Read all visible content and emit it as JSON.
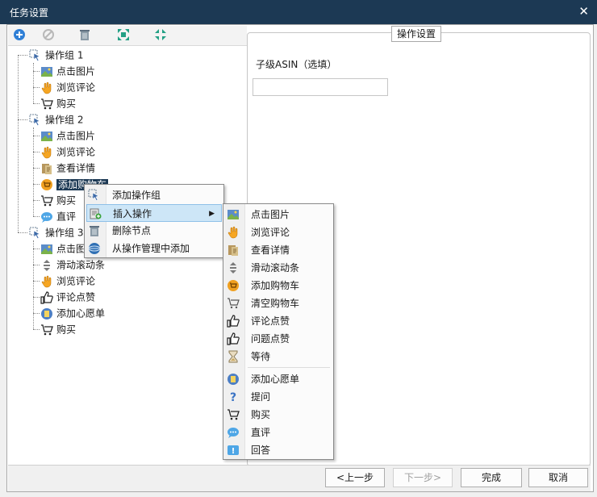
{
  "window": {
    "title": "任务设置",
    "close": "✕"
  },
  "toolbar": [
    {
      "name": "add-icon"
    },
    {
      "name": "disable-icon"
    },
    {
      "name": "delete-icon"
    },
    {
      "name": "expand-icon"
    },
    {
      "name": "collapse-icon"
    }
  ],
  "tree": [
    {
      "label": "操作组 1",
      "level": 0,
      "icon": "cursor-icon"
    },
    {
      "label": "点击图片",
      "level": 1,
      "icon": "image-icon"
    },
    {
      "label": "浏览评论",
      "level": 1,
      "icon": "hand-icon"
    },
    {
      "label": "购买",
      "level": 1,
      "icon": "cart-icon"
    },
    {
      "label": "操作组 2",
      "level": 0,
      "icon": "cursor-icon"
    },
    {
      "label": "点击图片",
      "level": 1,
      "icon": "image-icon"
    },
    {
      "label": "浏览评论",
      "level": 1,
      "icon": "hand-icon"
    },
    {
      "label": "查看详情",
      "level": 1,
      "icon": "book-icon"
    },
    {
      "label": "添加购物车",
      "level": 1,
      "icon": "add-cart-icon",
      "selected": true
    },
    {
      "label": "购买",
      "level": 1,
      "icon": "cart-icon"
    },
    {
      "label": "直评",
      "level": 1,
      "icon": "chat-icon"
    },
    {
      "label": "操作组 3",
      "level": 0,
      "icon": "cursor-icon"
    },
    {
      "label": "点击图片",
      "level": 1,
      "icon": "image-icon"
    },
    {
      "label": "滑动滚动条",
      "level": 1,
      "icon": "scroll-icon"
    },
    {
      "label": "浏览评论",
      "level": 1,
      "icon": "hand-icon"
    },
    {
      "label": "评论点赞",
      "level": 1,
      "icon": "thumb-icon"
    },
    {
      "label": "添加心愿单",
      "level": 1,
      "icon": "wishlist-icon"
    },
    {
      "label": "购买",
      "level": 1,
      "icon": "cart-icon"
    }
  ],
  "settings": {
    "group_title": "操作设置",
    "field_label": "子级ASIN（选填）",
    "field_value": ""
  },
  "context_menu": [
    {
      "label": "添加操作组",
      "icon": "cursor-icon"
    },
    {
      "label": "插入操作",
      "icon": "insert-icon",
      "highlighted": true,
      "submenu": true
    },
    {
      "label": "删除节点",
      "icon": "delete-icon"
    },
    {
      "label": "从操作管理中添加",
      "icon": "globe-icon"
    }
  ],
  "submenu": [
    {
      "label": "点击图片",
      "icon": "image-icon"
    },
    {
      "label": "浏览评论",
      "icon": "hand-icon"
    },
    {
      "label": "查看详情",
      "icon": "book-icon"
    },
    {
      "label": "滑动滚动条",
      "icon": "scroll-icon"
    },
    {
      "label": "添加购物车",
      "icon": "add-cart-icon"
    },
    {
      "label": "清空购物车",
      "icon": "empty-cart-icon"
    },
    {
      "label": "评论点赞",
      "icon": "thumb-icon"
    },
    {
      "label": "问题点赞",
      "icon": "thumb-icon"
    },
    {
      "label": "等待",
      "icon": "hourglass-icon",
      "separator_after": true
    },
    {
      "label": "添加心愿单",
      "icon": "wishlist-icon"
    },
    {
      "label": "提问",
      "icon": "question-icon"
    },
    {
      "label": "购买",
      "icon": "cart-icon"
    },
    {
      "label": "直评",
      "icon": "chat-icon"
    },
    {
      "label": "回答",
      "icon": "answer-icon"
    }
  ],
  "footer": {
    "prev_label": "<上一步",
    "next_label": "下一步>",
    "finish_label": "完成",
    "cancel_label": "取消"
  }
}
